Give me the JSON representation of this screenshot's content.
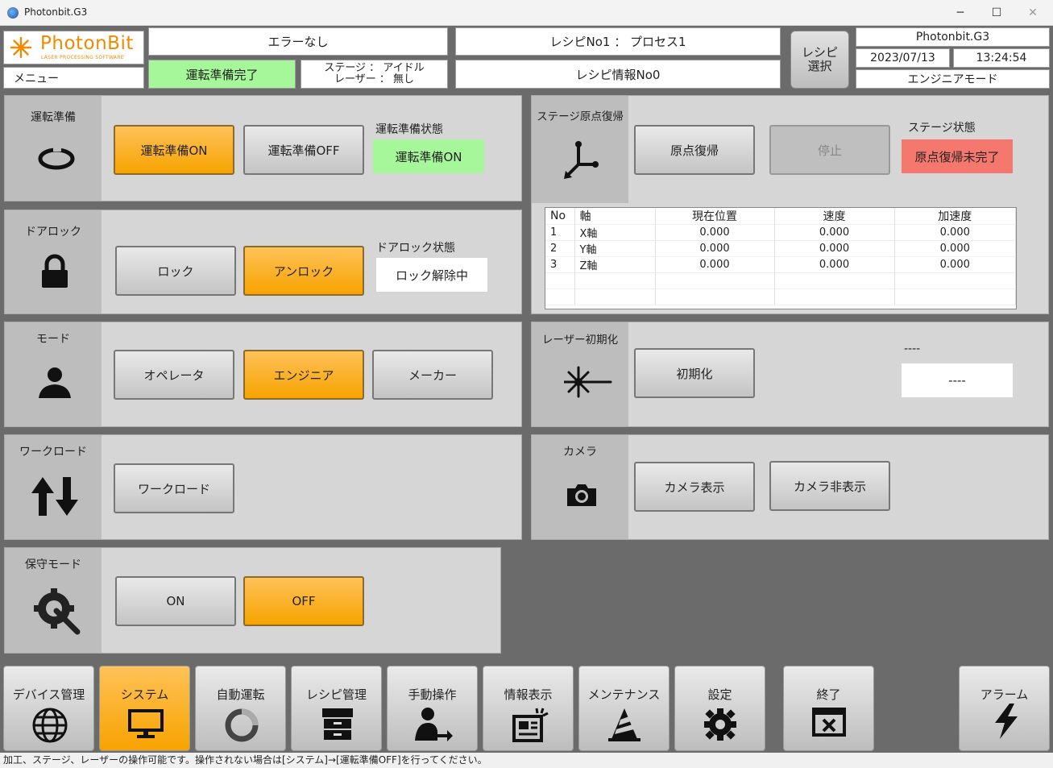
{
  "window": {
    "title": "Photonbit.G3",
    "minimize": "─",
    "maximize": "☐",
    "close": "✕"
  },
  "logo": {
    "brand": "PhotonBit",
    "tagline": "LASER PROCESSING SOFTWARE"
  },
  "header": {
    "menu": "メニュー",
    "error_status": "エラーなし",
    "run_ready_status": "運転準備完了",
    "stage_laser_status": "ステージ ： アイドル\nレーザー ： 無し",
    "recipe": "レシピNo1 ： プロセス1",
    "recipe_info": "レシピ情報No0",
    "recipe_select": "レシピ\n選択",
    "app_name": "Photonbit.G3",
    "date": "2023/07/13",
    "time": "13:24:54",
    "user_mode": "エンジニアモード"
  },
  "panels": {
    "run_prep": {
      "title": "運転準備",
      "on": "運転準備ON",
      "off": "運転準備OFF",
      "state_label": "運転準備状態",
      "state_value": "運転準備ON"
    },
    "door_lock": {
      "title": "ドアロック",
      "lock": "ロック",
      "unlock": "アンロック",
      "state_label": "ドアロック状態",
      "state_value": "ロック解除中"
    },
    "mode": {
      "title": "モード",
      "operator": "オペレータ",
      "engineer": "エンジニア",
      "maker": "メーカー"
    },
    "work_load": {
      "title": "ワークロード",
      "button": "ワークロード"
    },
    "maintenance_mode": {
      "title": "保守モード",
      "on": "ON",
      "off": "OFF"
    },
    "stage_home": {
      "title": "ステージ原点復帰",
      "home": "原点復帰",
      "stop": "停止",
      "state_label": "ステージ状態",
      "state_value": "原点復帰未完了"
    },
    "laser_init": {
      "title": "レーザー初期化",
      "init": "初期化",
      "state_label": "----",
      "state_value": "----"
    },
    "camera": {
      "title": "カメラ",
      "show": "カメラ表示",
      "hide": "カメラ非表示"
    }
  },
  "axis_table": {
    "headers": [
      "No",
      "軸",
      "現在位置",
      "速度",
      "加速度"
    ],
    "rows": [
      [
        "1",
        "X軸",
        "0.000",
        "0.000",
        "0.000"
      ],
      [
        "2",
        "Y軸",
        "0.000",
        "0.000",
        "0.000"
      ],
      [
        "3",
        "Z軸",
        "0.000",
        "0.000",
        "0.000"
      ]
    ]
  },
  "nav": {
    "device": "デバイス管理",
    "system": "システム",
    "auto": "自動運転",
    "recipe": "レシピ管理",
    "manual": "手動操作",
    "info": "情報表示",
    "maintenance": "メンテナンス",
    "settings": "設定",
    "exit": "終了",
    "alarm": "アラーム"
  },
  "status_bar": "加工、ステージ、レーザーの操作可能です。操作されない場合は[システム]→[運転準備OFF]を行ってください。",
  "colors": {
    "accent_orange": "#f7a300",
    "ok_green": "#a6f79a",
    "alert_red": "#f5786f",
    "brand_orange": "#f08a00"
  }
}
